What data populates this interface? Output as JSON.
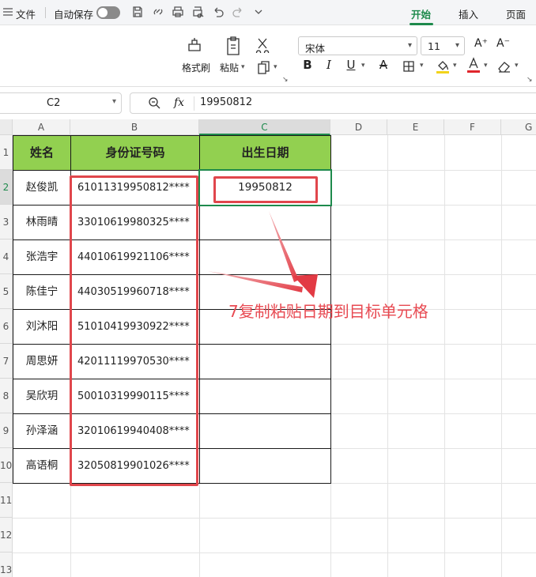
{
  "topbar": {
    "file": "文件",
    "autosave": "自动保存",
    "tabs": [
      "开始",
      "插入",
      "页面"
    ]
  },
  "ribbon": {
    "format_painter": "格式刷",
    "paste": "粘贴",
    "font_name": "宋体",
    "font_size": "11",
    "icons": [
      "format-painter-icon",
      "paste-icon",
      "cut-icon",
      "copy-icon",
      "bold-icon",
      "italic-icon",
      "underline-icon",
      "strikethrough-icon",
      "border-icon",
      "fill-color-icon",
      "font-color-icon",
      "eraser-icon"
    ],
    "format_buttons": {
      "bold": "B",
      "italic": "I",
      "underline": "U",
      "strike": "A"
    }
  },
  "formula_bar": {
    "cell_ref": "C2",
    "fx": "fx",
    "value": "19950812"
  },
  "columns": [
    "A",
    "B",
    "C",
    "D",
    "E",
    "F",
    "G"
  ],
  "rows": [
    "1",
    "2",
    "3",
    "4",
    "5",
    "6",
    "7",
    "8",
    "9",
    "10",
    "11",
    "12",
    "13"
  ],
  "table": {
    "headers": [
      "姓名",
      "身份证号码",
      "出生日期"
    ],
    "names": [
      "赵俊凯",
      "林雨晴",
      "张浩宇",
      "陈佳宁",
      "刘沐阳",
      "周思妍",
      "吴欣玥",
      "孙泽涵",
      "高语桐"
    ],
    "ids": [
      "61011319950812****",
      "33010619980325****",
      "44010619921106****",
      "44030519960718****",
      "51010419930922****",
      "42011119970530****",
      "50010319990115****",
      "32010619940408****",
      "32050819901026****"
    ],
    "birth": [
      "19950812"
    ]
  },
  "annotation": "7复制粘贴日期到目标单元格",
  "colors": {
    "header_fill": "#92d050",
    "accent": "#1e8a4c",
    "annotation": "#e84a52"
  }
}
